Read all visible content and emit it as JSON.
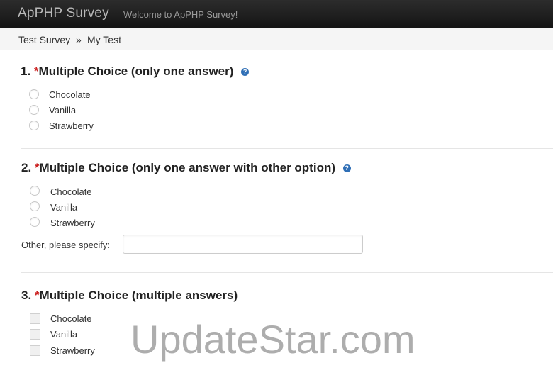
{
  "header": {
    "brand": "ApPHP Survey",
    "welcome": "Welcome to ApPHP Survey!"
  },
  "breadcrumb": {
    "items": [
      "Test Survey",
      "My Test"
    ],
    "separator": "»"
  },
  "questions": [
    {
      "number": "1.",
      "required_mark": "*",
      "title": "Multiple Choice (only one answer)",
      "type": "radio",
      "options": [
        "Chocolate",
        "Vanilla",
        "Strawberry"
      ]
    },
    {
      "number": "2.",
      "required_mark": "*",
      "title": "Multiple Choice (only one answer with other option)",
      "type": "radio",
      "options": [
        "Chocolate",
        "Vanilla",
        "Strawberry"
      ],
      "other_label": "Other, please specify:",
      "other_value": ""
    },
    {
      "number": "3.",
      "required_mark": "*",
      "title": "Multiple Choice (multiple answers)",
      "type": "checkbox",
      "options": [
        "Chocolate",
        "Vanilla",
        "Strawberry"
      ]
    }
  ],
  "watermark": "UpdateStar.com",
  "colors": {
    "navbar": "#1b1b1b",
    "required": "#cc2222",
    "help_icon": "#2f6fb6"
  }
}
